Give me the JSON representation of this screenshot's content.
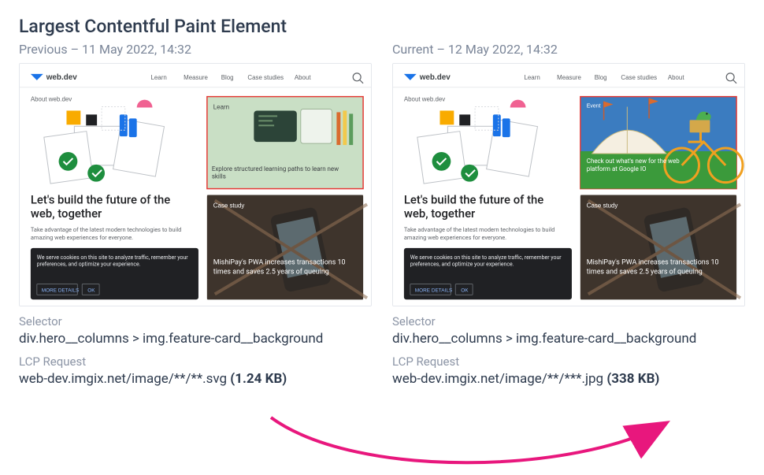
{
  "title": "Largest Contentful Paint Element",
  "previous": {
    "label": "Previous – 11 May 2022, 14:32",
    "nav": {
      "brand": "web.dev",
      "items": [
        "Learn",
        "Measure",
        "Blog",
        "Case studies",
        "About"
      ]
    },
    "crumb": "About web.dev",
    "card1": {
      "tag": "Learn",
      "caption": "Explore structured learning paths to learn new skills"
    },
    "heroTitle": "Let's build the future of the web, together",
    "heroSub": "Take advantage of the latest modern technologies to build amazing web experiences for everyone.",
    "cookie": {
      "msg": "We serve cookies on this site to analyze traffic, remember your preferences, and optimize your experience.",
      "more": "MORE DETAILS",
      "ok": "OK"
    },
    "card2": {
      "tag": "Case study",
      "caption": "MishiPay's PWA increases transactions 10 times and saves 2.5 years of queuing"
    },
    "selectorLabel": "Selector",
    "selector": "div.hero__columns > img.feature-card__background",
    "reqLabel": "LCP Request",
    "reqText": "web-dev.imgix.net/image/**/**.svg ",
    "reqSize": "(1.24 KB)"
  },
  "current": {
    "label": "Current – 12 May 2022, 14:32",
    "nav": {
      "brand": "web.dev",
      "items": [
        "Learn",
        "Measure",
        "Blog",
        "Case studies",
        "About"
      ]
    },
    "crumb": "About web.dev",
    "card1": {
      "tag": "Event",
      "caption": "Check out what's new for the web platform at Google IO"
    },
    "heroTitle": "Let's build the future of the web, together",
    "heroSub": "Take advantage of the latest modern technologies to build amazing web experiences for everyone.",
    "cookie": {
      "msg": "We serve cookies on this site to analyze traffic, remember your preferences, and optimize your experience.",
      "more": "MORE DETAILS",
      "ok": "OK"
    },
    "card2": {
      "tag": "Case study",
      "caption": "MishiPay's PWA increases transactions 10 times and saves 2.5 years of queuing"
    },
    "selectorLabel": "Selector",
    "selector": "div.hero__columns > img.feature-card__background",
    "reqLabel": "LCP Request",
    "reqText": "web-dev.imgix.net/image/**/***.jpg ",
    "reqSize": "(338 KB)"
  }
}
